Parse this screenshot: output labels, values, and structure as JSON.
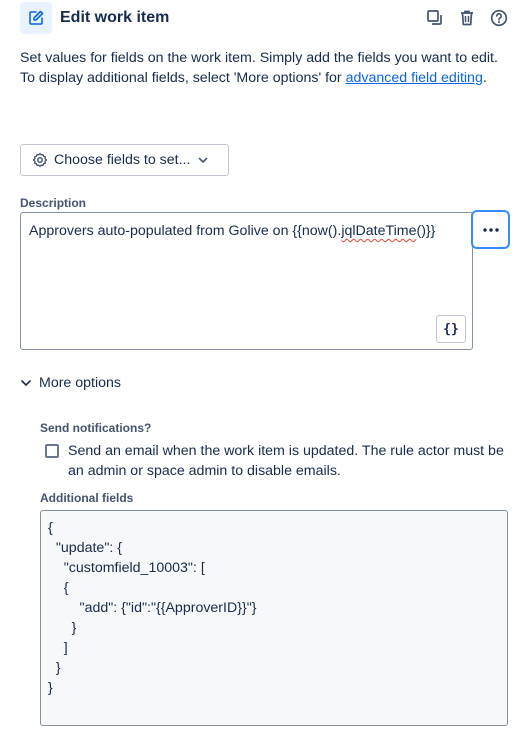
{
  "header": {
    "title": "Edit work item",
    "icons": [
      "edit-icon",
      "duplicate-icon",
      "trash-icon",
      "help-icon"
    ]
  },
  "intro": {
    "line1": "Set values for fields on the work item. Simply add the fields you want to edit.",
    "line2_prefix": "To display additional fields, select 'More options' for ",
    "line2_link": "advanced field editing",
    "line2_suffix": "."
  },
  "choose_fields": {
    "label": "Choose fields to set..."
  },
  "description": {
    "label": "Description",
    "value_prefix": "Approvers auto-populated from Golive on {{now().",
    "value_misspelled": "jqlDateTime",
    "value_suffix": "()}}"
  },
  "more_options": {
    "label": "More options"
  },
  "notifications": {
    "label": "Send notifications?",
    "checkbox_label": "Send an email when the work item is updated. The rule actor must be an admin or space admin to disable emails.",
    "checked": false
  },
  "additional_fields": {
    "label": "Additional fields",
    "lines": [
      "{",
      "  \"update\": {",
      "    \"customfield_10003\": [",
      "    {",
      "        \"add\": {\"id\":\"{{ApproverID}}\"}",
      "      }",
      "    ]",
      "  }",
      "}"
    ]
  },
  "colors": {
    "accent": "#0c66e4",
    "focus_border": "#388bff",
    "icon_bg": "#e9f2ff",
    "spell_error": "#e34935"
  }
}
